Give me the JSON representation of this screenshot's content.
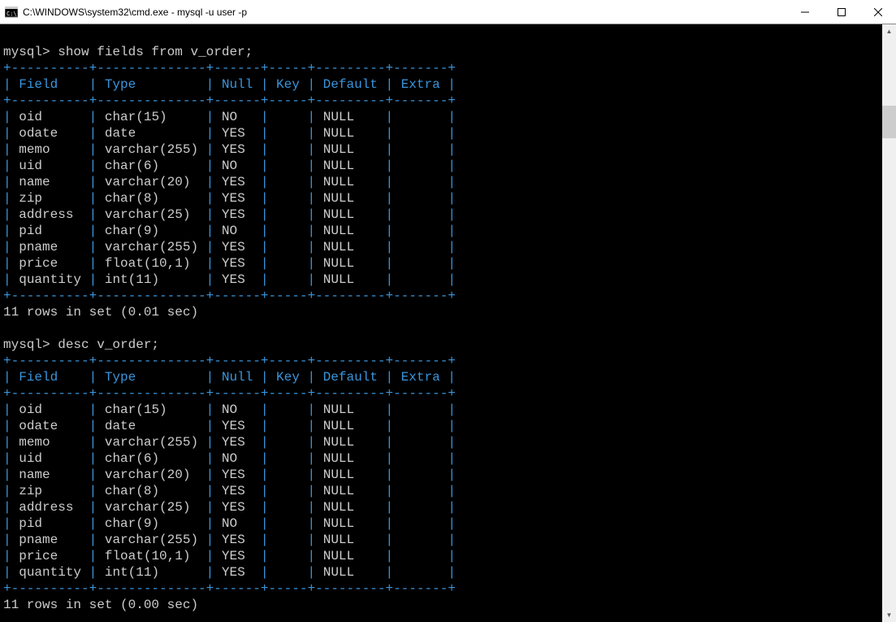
{
  "window": {
    "title": "C:\\WINDOWS\\system32\\cmd.exe - mysql  -u user -p"
  },
  "prompt": "mysql>",
  "commands": {
    "cmd1": "show fields from v_order;",
    "cmd2": "desc v_order;"
  },
  "table": {
    "headers": [
      "Field",
      "Type",
      "Null",
      "Key",
      "Default",
      "Extra"
    ],
    "rows": [
      {
        "field": "oid",
        "type": "char(15)",
        "null": "NO",
        "key": "",
        "default": "NULL",
        "extra": ""
      },
      {
        "field": "odate",
        "type": "date",
        "null": "YES",
        "key": "",
        "default": "NULL",
        "extra": ""
      },
      {
        "field": "memo",
        "type": "varchar(255)",
        "null": "YES",
        "key": "",
        "default": "NULL",
        "extra": ""
      },
      {
        "field": "uid",
        "type": "char(6)",
        "null": "NO",
        "key": "",
        "default": "NULL",
        "extra": ""
      },
      {
        "field": "name",
        "type": "varchar(20)",
        "null": "YES",
        "key": "",
        "default": "NULL",
        "extra": ""
      },
      {
        "field": "zip",
        "type": "char(8)",
        "null": "YES",
        "key": "",
        "default": "NULL",
        "extra": ""
      },
      {
        "field": "address",
        "type": "varchar(25)",
        "null": "YES",
        "key": "",
        "default": "NULL",
        "extra": ""
      },
      {
        "field": "pid",
        "type": "char(9)",
        "null": "NO",
        "key": "",
        "default": "NULL",
        "extra": ""
      },
      {
        "field": "pname",
        "type": "varchar(255)",
        "null": "YES",
        "key": "",
        "default": "NULL",
        "extra": ""
      },
      {
        "field": "price",
        "type": "float(10,1)",
        "null": "YES",
        "key": "",
        "default": "NULL",
        "extra": ""
      },
      {
        "field": "quantity",
        "type": "int(11)",
        "null": "YES",
        "key": "",
        "default": "NULL",
        "extra": ""
      }
    ]
  },
  "status1": "11 rows in set (0.01 sec)",
  "status2": "11 rows in set (0.00 sec)"
}
